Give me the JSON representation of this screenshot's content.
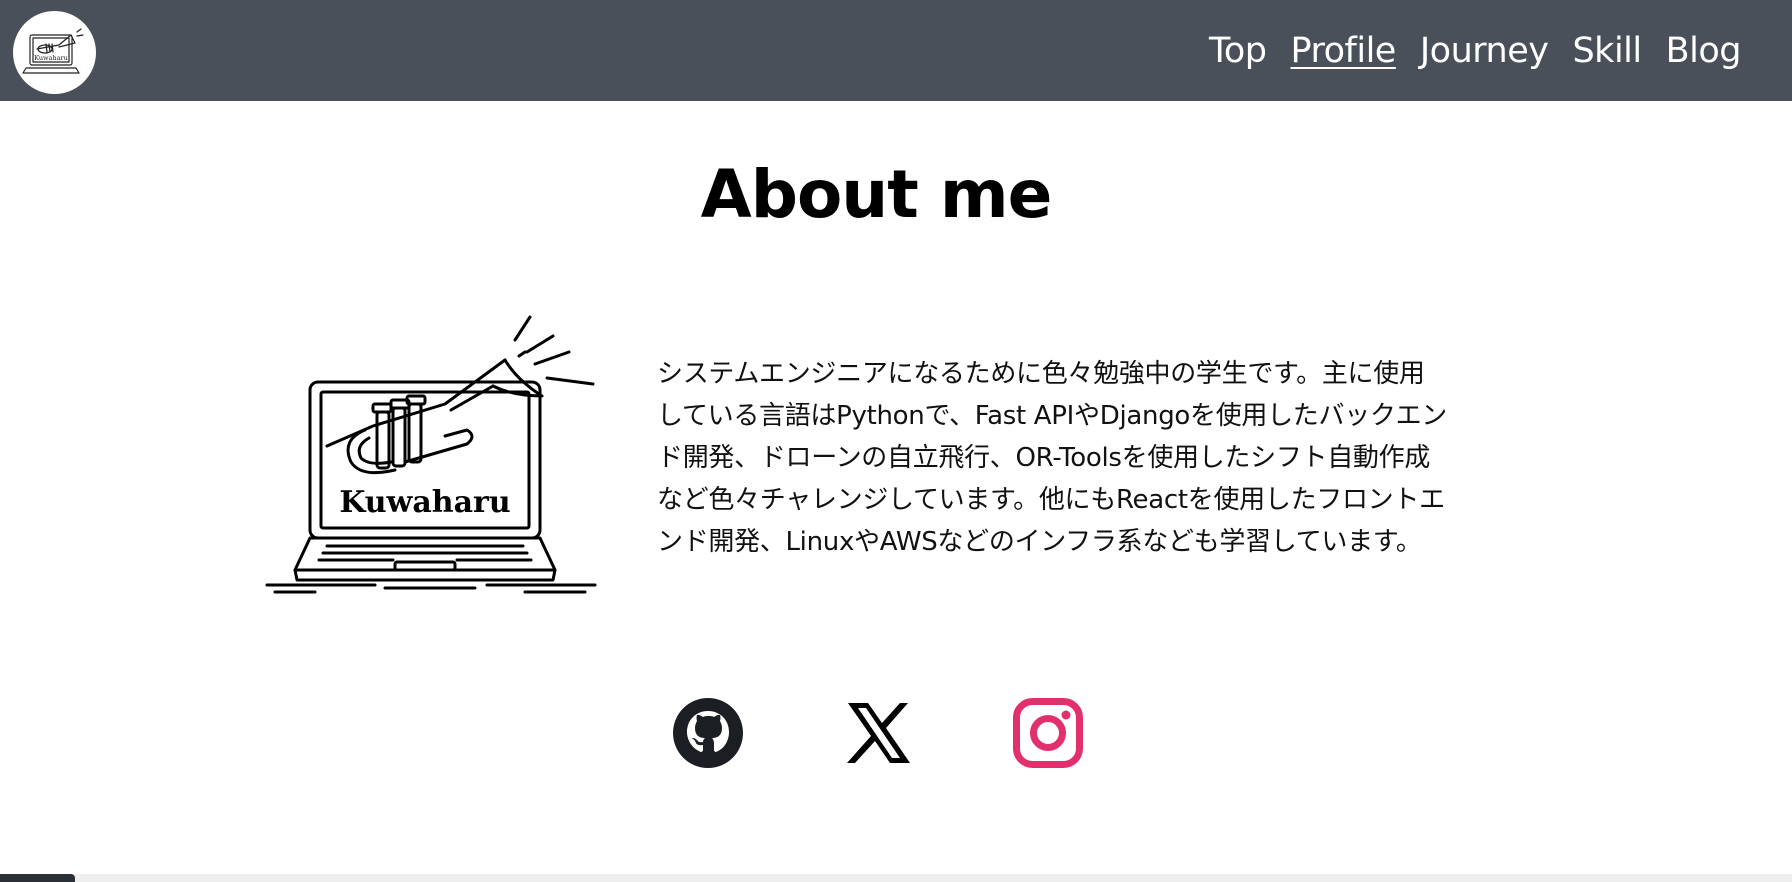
{
  "navbar": {
    "logo_text": "Kuwaharu",
    "items": [
      {
        "label": "Top",
        "active": false
      },
      {
        "label": "Profile",
        "active": true
      },
      {
        "label": "Journey",
        "active": false
      },
      {
        "label": "Skill",
        "active": false
      },
      {
        "label": "Blog",
        "active": false
      }
    ],
    "background_color": "#4a5059"
  },
  "main": {
    "title": "About me",
    "illustration_text": "Kuwaharu",
    "bio": "システムエンジニアになるために色々勉強中の学生です。主に使用している言語はPythonで、Fast APIやDjangoを使用したバックエンド開発、ドローンの自立飛行、OR-Toolsを使用したシフト自動作成など色々チャレンジしています。他にもReactを使用したフロントエンド開発、LinuxやAWSなどのインフラ系なども学習しています。"
  },
  "social": [
    {
      "name": "github",
      "icon": "github-icon",
      "color": "#1b1f23"
    },
    {
      "name": "x",
      "icon": "x-icon",
      "color": "#000000"
    },
    {
      "name": "instagram",
      "icon": "instagram-icon",
      "color": "#e1306c"
    }
  ]
}
